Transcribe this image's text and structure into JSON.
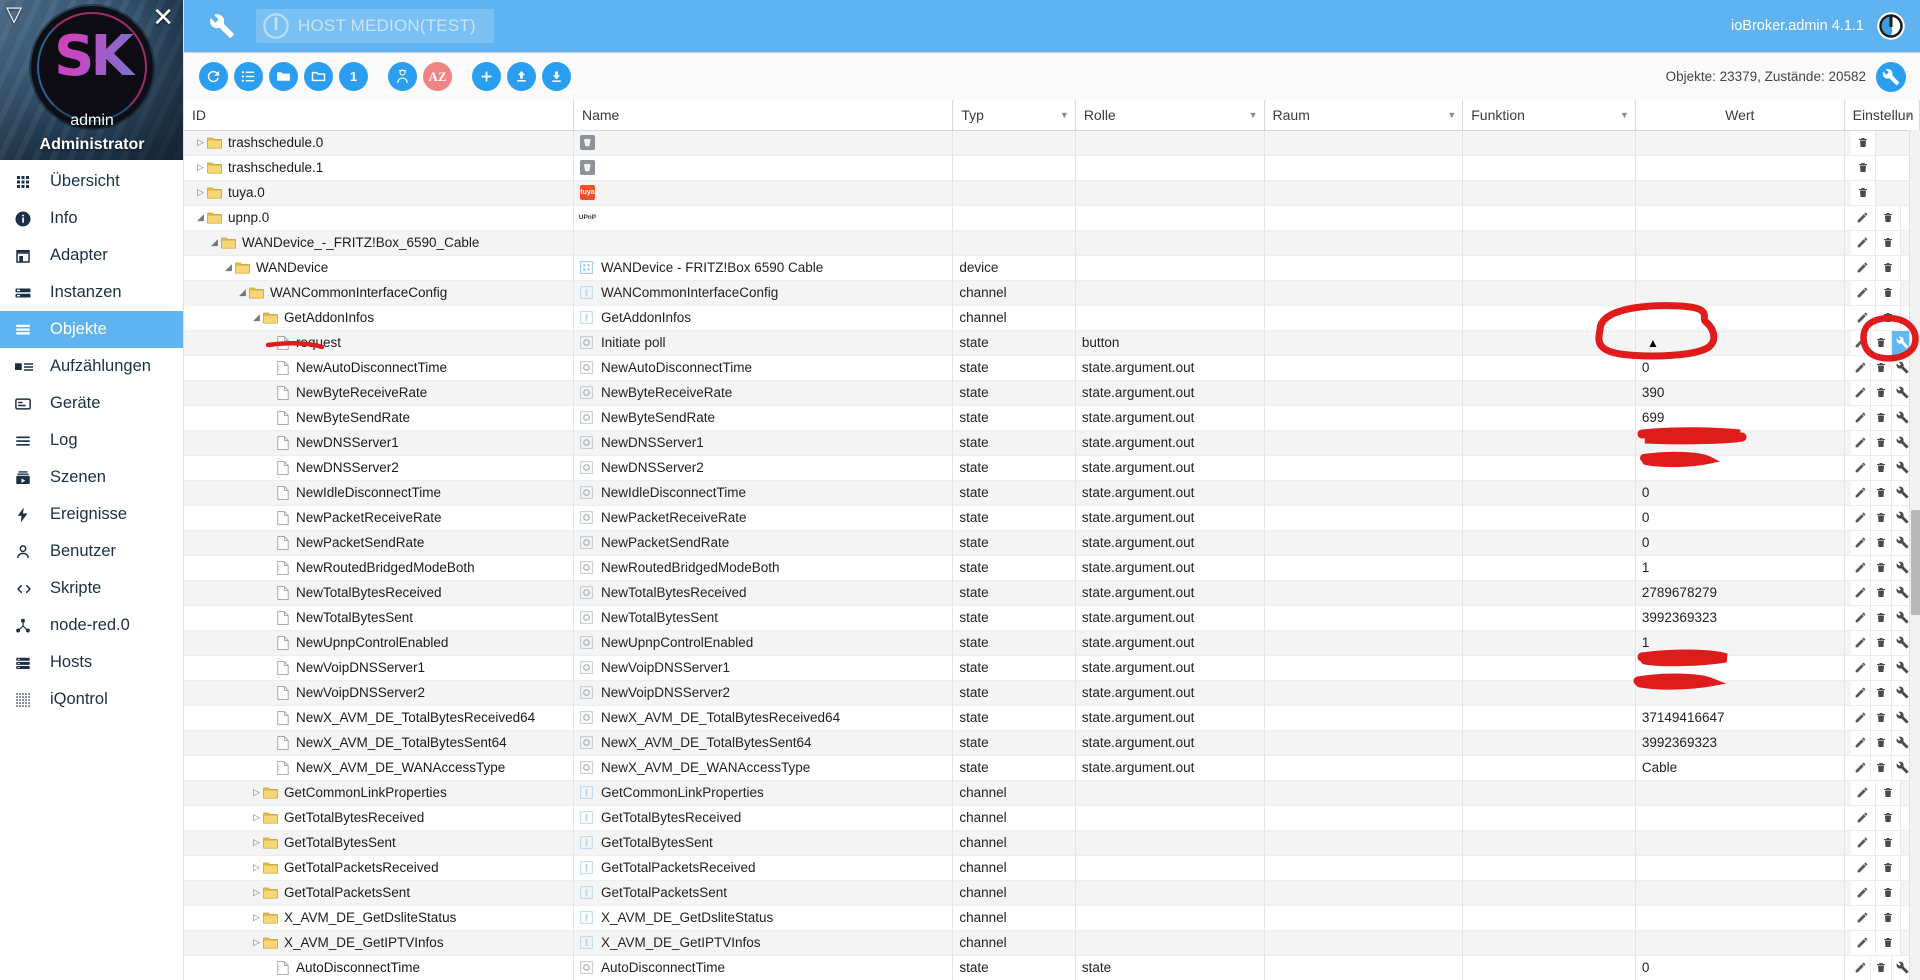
{
  "sidebar": {
    "user": "admin",
    "role": "Administrator",
    "logo_text": "SK",
    "collapse_icon": "collapse-triangle-icon",
    "close_icon": "close-icon",
    "items": [
      {
        "label": "Übersicht",
        "icon": "grid-icon",
        "active": false
      },
      {
        "label": "Info",
        "icon": "info-icon",
        "active": false
      },
      {
        "label": "Adapter",
        "icon": "shop-icon",
        "active": false
      },
      {
        "label": "Instanzen",
        "icon": "instances-icon",
        "active": false
      },
      {
        "label": "Objekte",
        "icon": "objects-icon",
        "active": true
      },
      {
        "label": "Aufzählungen",
        "icon": "enums-icon",
        "active": false
      },
      {
        "label": "Geräte",
        "icon": "devices-icon",
        "active": false
      },
      {
        "label": "Log",
        "icon": "log-icon",
        "active": false
      },
      {
        "label": "Szenen",
        "icon": "scenes-icon",
        "active": false
      },
      {
        "label": "Ereignisse",
        "icon": "events-icon",
        "active": false
      },
      {
        "label": "Benutzer",
        "icon": "user-icon",
        "active": false
      },
      {
        "label": "Skripte",
        "icon": "code-icon",
        "active": false
      },
      {
        "label": "node-red.0",
        "icon": "node-red-icon",
        "active": false
      },
      {
        "label": "Hosts",
        "icon": "hosts-icon",
        "active": false
      },
      {
        "label": "iQontrol",
        "icon": "iqontrol-icon",
        "active": false
      }
    ]
  },
  "topbar": {
    "wrench_icon": "wrench-icon",
    "host_label": "HOST MEDION(TEST)",
    "host_power_icon": "power-icon",
    "version": "ioBroker.admin 4.1.1",
    "logo_icon": "iobroker-logo-icon",
    "accent_color": "#5eb3f0"
  },
  "toolbar": {
    "buttons": [
      {
        "name": "refresh-button",
        "icon": "refresh-icon",
        "style": "blue"
      },
      {
        "name": "list-view-button",
        "icon": "list-icon",
        "style": "blue"
      },
      {
        "name": "expand-all-button",
        "icon": "folder-open-icon",
        "style": "blue"
      },
      {
        "name": "collapse-all-button",
        "icon": "folder-icon",
        "style": "blue"
      },
      {
        "name": "expand-level-button",
        "icon": "number-one-icon",
        "style": "blue",
        "text": "1"
      },
      {
        "name": "expert-mode-button",
        "icon": "expert-icon",
        "style": "blue"
      },
      {
        "name": "sort-alpha-button",
        "icon": "az-sort-icon",
        "style": "red",
        "text": "AZ"
      },
      {
        "name": "add-object-button",
        "icon": "plus-icon",
        "style": "blue"
      },
      {
        "name": "import-button",
        "icon": "upload-icon",
        "style": "blue"
      },
      {
        "name": "export-button",
        "icon": "download-icon",
        "style": "blue"
      }
    ],
    "counts": "Objekte: 23379, Zustände: 20582",
    "settings_icon": "wrench-icon"
  },
  "table": {
    "columns": [
      {
        "label": "ID",
        "filter": false,
        "align": "left"
      },
      {
        "label": "Name",
        "filter": false,
        "align": "left"
      },
      {
        "label": "Typ",
        "filter": true,
        "align": "left"
      },
      {
        "label": "Rolle",
        "filter": true,
        "align": "left"
      },
      {
        "label": "Raum",
        "filter": true,
        "align": "left"
      },
      {
        "label": "Funktion",
        "filter": true,
        "align": "left"
      },
      {
        "label": "Wert",
        "filter": false,
        "align": "center"
      },
      {
        "label": "Einstellun",
        "filter": true,
        "align": "left"
      }
    ],
    "rows": [
      {
        "indent": 0,
        "twisty": "closed",
        "icon": "folder-icon",
        "id": "trashschedule.0",
        "name": "",
        "name_icon": "trashschedule-adapter-icon",
        "type": "",
        "role": "",
        "room": "",
        "func": "",
        "value": "",
        "actions": [
          "delete"
        ]
      },
      {
        "indent": 0,
        "twisty": "closed",
        "icon": "folder-icon",
        "id": "trashschedule.1",
        "name": "",
        "name_icon": "trashschedule-adapter-icon",
        "type": "",
        "role": "",
        "room": "",
        "func": "",
        "value": "",
        "actions": [
          "delete"
        ]
      },
      {
        "indent": 0,
        "twisty": "closed",
        "icon": "folder-icon",
        "id": "tuya.0",
        "name": "",
        "name_icon": "tuya-adapter-icon",
        "type": "",
        "role": "",
        "room": "",
        "func": "",
        "value": "",
        "actions": [
          "delete"
        ]
      },
      {
        "indent": 0,
        "twisty": "open",
        "icon": "folder-icon",
        "id": "upnp.0",
        "name": "",
        "name_icon": "upnp-adapter-icon",
        "type": "",
        "role": "",
        "room": "",
        "func": "",
        "value": "",
        "actions": [
          "edit",
          "delete"
        ]
      },
      {
        "indent": 1,
        "twisty": "open",
        "icon": "folder-icon",
        "id": "WANDevice_-_FRITZ!Box_6590_Cable",
        "name": "",
        "name_icon": "",
        "type": "",
        "role": "",
        "room": "",
        "func": "",
        "value": "",
        "actions": [
          "edit",
          "delete"
        ]
      },
      {
        "indent": 2,
        "twisty": "open",
        "icon": "folder-icon",
        "id": "WANDevice",
        "name": "WANDevice - FRITZ!Box 6590 Cable",
        "name_icon": "device-icon",
        "type": "device",
        "role": "",
        "room": "",
        "func": "",
        "value": "",
        "actions": [
          "edit",
          "delete"
        ]
      },
      {
        "indent": 3,
        "twisty": "open",
        "icon": "folder-icon",
        "id": "WANCommonInterfaceConfig",
        "name": "WANCommonInterfaceConfig",
        "name_icon": "channel-icon",
        "type": "channel",
        "role": "",
        "room": "",
        "func": "",
        "value": "",
        "actions": [
          "edit",
          "delete"
        ]
      },
      {
        "indent": 4,
        "twisty": "open",
        "icon": "folder-icon",
        "id": "GetAddonInfos",
        "name": "GetAddonInfos",
        "name_icon": "channel-icon",
        "type": "channel",
        "role": "",
        "room": "",
        "func": "",
        "value": "",
        "actions": [
          "edit",
          "delete"
        ]
      },
      {
        "indent": 5,
        "twisty": "none",
        "icon": "doc-icon",
        "id": "request",
        "name": "Initiate poll",
        "name_icon": "state-icon",
        "type": "state",
        "role": "button",
        "room": "",
        "func": "",
        "value": "▲",
        "value_kind": "button",
        "actions": [
          "edit",
          "delete",
          "settings-highlight"
        ]
      },
      {
        "indent": 5,
        "twisty": "none",
        "icon": "doc-icon",
        "id": "NewAutoDisconnectTime",
        "name": "NewAutoDisconnectTime",
        "name_icon": "state-icon",
        "type": "state",
        "role": "state.argument.out",
        "room": "",
        "func": "",
        "value": "0",
        "actions": [
          "edit",
          "delete",
          "settings"
        ]
      },
      {
        "indent": 5,
        "twisty": "none",
        "icon": "doc-icon",
        "id": "NewByteReceiveRate",
        "name": "NewByteReceiveRate",
        "name_icon": "state-icon",
        "type": "state",
        "role": "state.argument.out",
        "room": "",
        "func": "",
        "value": "390",
        "actions": [
          "edit",
          "delete",
          "settings"
        ]
      },
      {
        "indent": 5,
        "twisty": "none",
        "icon": "doc-icon",
        "id": "NewByteSendRate",
        "name": "NewByteSendRate",
        "name_icon": "state-icon",
        "type": "state",
        "role": "state.argument.out",
        "room": "",
        "func": "",
        "value": "699",
        "actions": [
          "edit",
          "delete",
          "settings"
        ]
      },
      {
        "indent": 5,
        "twisty": "none",
        "icon": "doc-icon",
        "id": "NewDNSServer1",
        "name": "NewDNSServer1",
        "name_icon": "state-icon",
        "type": "state",
        "role": "state.argument.out",
        "room": "",
        "func": "",
        "value": "",
        "value_kind": "redacted-long",
        "actions": [
          "edit",
          "delete",
          "settings"
        ]
      },
      {
        "indent": 5,
        "twisty": "none",
        "icon": "doc-icon",
        "id": "NewDNSServer2",
        "name": "NewDNSServer2",
        "name_icon": "state-icon",
        "type": "state",
        "role": "state.argument.out",
        "room": "",
        "func": "",
        "value": "",
        "value_kind": "redacted-short",
        "actions": [
          "edit",
          "delete",
          "settings"
        ]
      },
      {
        "indent": 5,
        "twisty": "none",
        "icon": "doc-icon",
        "id": "NewIdleDisconnectTime",
        "name": "NewIdleDisconnectTime",
        "name_icon": "state-icon",
        "type": "state",
        "role": "state.argument.out",
        "room": "",
        "func": "",
        "value": "0",
        "actions": [
          "edit",
          "delete",
          "settings"
        ]
      },
      {
        "indent": 5,
        "twisty": "none",
        "icon": "doc-icon",
        "id": "NewPacketReceiveRate",
        "name": "NewPacketReceiveRate",
        "name_icon": "state-icon",
        "type": "state",
        "role": "state.argument.out",
        "room": "",
        "func": "",
        "value": "0",
        "actions": [
          "edit",
          "delete",
          "settings"
        ]
      },
      {
        "indent": 5,
        "twisty": "none",
        "icon": "doc-icon",
        "id": "NewPacketSendRate",
        "name": "NewPacketSendRate",
        "name_icon": "state-icon",
        "type": "state",
        "role": "state.argument.out",
        "room": "",
        "func": "",
        "value": "0",
        "actions": [
          "edit",
          "delete",
          "settings"
        ]
      },
      {
        "indent": 5,
        "twisty": "none",
        "icon": "doc-icon",
        "id": "NewRoutedBridgedModeBoth",
        "name": "NewRoutedBridgedModeBoth",
        "name_icon": "state-icon",
        "type": "state",
        "role": "state.argument.out",
        "room": "",
        "func": "",
        "value": "1",
        "actions": [
          "edit",
          "delete",
          "settings"
        ]
      },
      {
        "indent": 5,
        "twisty": "none",
        "icon": "doc-icon",
        "id": "NewTotalBytesReceived",
        "name": "NewTotalBytesReceived",
        "name_icon": "state-icon",
        "type": "state",
        "role": "state.argument.out",
        "room": "",
        "func": "",
        "value": "2789678279",
        "actions": [
          "edit",
          "delete",
          "settings"
        ]
      },
      {
        "indent": 5,
        "twisty": "none",
        "icon": "doc-icon",
        "id": "NewTotalBytesSent",
        "name": "NewTotalBytesSent",
        "name_icon": "state-icon",
        "type": "state",
        "role": "state.argument.out",
        "room": "",
        "func": "",
        "value": "3992369323",
        "actions": [
          "edit",
          "delete",
          "settings"
        ]
      },
      {
        "indent": 5,
        "twisty": "none",
        "icon": "doc-icon",
        "id": "NewUpnpControlEnabled",
        "name": "NewUpnpControlEnabled",
        "name_icon": "state-icon",
        "type": "state",
        "role": "state.argument.out",
        "room": "",
        "func": "",
        "value": "1",
        "actions": [
          "edit",
          "delete",
          "settings"
        ]
      },
      {
        "indent": 5,
        "twisty": "none",
        "icon": "doc-icon",
        "id": "NewVoipDNSServer1",
        "name": "NewVoipDNSServer1",
        "name_icon": "state-icon",
        "type": "state",
        "role": "state.argument.out",
        "room": "",
        "func": "",
        "value": "",
        "value_kind": "redacted-long",
        "actions": [
          "edit",
          "delete",
          "settings"
        ]
      },
      {
        "indent": 5,
        "twisty": "none",
        "icon": "doc-icon",
        "id": "NewVoipDNSServer2",
        "name": "NewVoipDNSServer2",
        "name_icon": "state-icon",
        "type": "state",
        "role": "state.argument.out",
        "room": "",
        "func": "",
        "value": "",
        "value_kind": "redacted-short",
        "actions": [
          "edit",
          "delete",
          "settings"
        ]
      },
      {
        "indent": 5,
        "twisty": "none",
        "icon": "doc-icon",
        "id": "NewX_AVM_DE_TotalBytesReceived64",
        "name": "NewX_AVM_DE_TotalBytesReceived64",
        "name_icon": "state-icon",
        "type": "state",
        "role": "state.argument.out",
        "room": "",
        "func": "",
        "value": "37149416647",
        "actions": [
          "edit",
          "delete",
          "settings"
        ]
      },
      {
        "indent": 5,
        "twisty": "none",
        "icon": "doc-icon",
        "id": "NewX_AVM_DE_TotalBytesSent64",
        "name": "NewX_AVM_DE_TotalBytesSent64",
        "name_icon": "state-icon",
        "type": "state",
        "role": "state.argument.out",
        "room": "",
        "func": "",
        "value": "3992369323",
        "actions": [
          "edit",
          "delete",
          "settings"
        ]
      },
      {
        "indent": 5,
        "twisty": "none",
        "icon": "doc-icon",
        "id": "NewX_AVM_DE_WANAccessType",
        "name": "NewX_AVM_DE_WANAccessType",
        "name_icon": "state-icon",
        "type": "state",
        "role": "state.argument.out",
        "room": "",
        "func": "",
        "value": "Cable",
        "value_kind": "text",
        "actions": [
          "edit",
          "delete",
          "settings"
        ]
      },
      {
        "indent": 4,
        "twisty": "closed",
        "icon": "folder-icon",
        "id": "GetCommonLinkProperties",
        "name": "GetCommonLinkProperties",
        "name_icon": "channel-icon",
        "type": "channel",
        "role": "",
        "room": "",
        "func": "",
        "value": "",
        "actions": [
          "edit",
          "delete"
        ]
      },
      {
        "indent": 4,
        "twisty": "closed",
        "icon": "folder-icon",
        "id": "GetTotalBytesReceived",
        "name": "GetTotalBytesReceived",
        "name_icon": "channel-icon",
        "type": "channel",
        "role": "",
        "room": "",
        "func": "",
        "value": "",
        "actions": [
          "edit",
          "delete"
        ]
      },
      {
        "indent": 4,
        "twisty": "closed",
        "icon": "folder-icon",
        "id": "GetTotalBytesSent",
        "name": "GetTotalBytesSent",
        "name_icon": "channel-icon",
        "type": "channel",
        "role": "",
        "room": "",
        "func": "",
        "value": "",
        "actions": [
          "edit",
          "delete"
        ]
      },
      {
        "indent": 4,
        "twisty": "closed",
        "icon": "folder-icon",
        "id": "GetTotalPacketsReceived",
        "name": "GetTotalPacketsReceived",
        "name_icon": "channel-icon",
        "type": "channel",
        "role": "",
        "room": "",
        "func": "",
        "value": "",
        "actions": [
          "edit",
          "delete"
        ]
      },
      {
        "indent": 4,
        "twisty": "closed",
        "icon": "folder-icon",
        "id": "GetTotalPacketsSent",
        "name": "GetTotalPacketsSent",
        "name_icon": "channel-icon",
        "type": "channel",
        "role": "",
        "room": "",
        "func": "",
        "value": "",
        "actions": [
          "edit",
          "delete"
        ]
      },
      {
        "indent": 4,
        "twisty": "closed",
        "icon": "folder-icon",
        "id": "X_AVM_DE_GetDsliteStatus",
        "name": "X_AVM_DE_GetDsliteStatus",
        "name_icon": "channel-icon",
        "type": "channel",
        "role": "",
        "room": "",
        "func": "",
        "value": "",
        "actions": [
          "edit",
          "delete"
        ]
      },
      {
        "indent": 4,
        "twisty": "closed",
        "icon": "folder-icon",
        "id": "X_AVM_DE_GetIPTVInfos",
        "name": "X_AVM_DE_GetIPTVInfos",
        "name_icon": "channel-icon",
        "type": "channel",
        "role": "",
        "room": "",
        "func": "",
        "value": "",
        "actions": [
          "edit",
          "delete"
        ]
      },
      {
        "indent": 5,
        "twisty": "none",
        "icon": "doc-icon",
        "id": "AutoDisconnectTime",
        "name": "AutoDisconnectTime",
        "name_icon": "state-icon",
        "type": "state",
        "role": "state",
        "room": "",
        "func": "",
        "value": "0",
        "actions": [
          "edit",
          "delete",
          "settings"
        ]
      }
    ]
  },
  "annotations": {
    "color": "#e01b1b",
    "marks": [
      {
        "name": "circle-around-request-value",
        "type": "ellipse"
      },
      {
        "name": "circle-around-settings-wrench",
        "type": "ellipse"
      },
      {
        "name": "underline-request-id",
        "type": "underline"
      },
      {
        "name": "redaction-dns-server-1",
        "type": "scribble"
      },
      {
        "name": "redaction-dns-server-2",
        "type": "scribble"
      },
      {
        "name": "redaction-voip-dns-server-1",
        "type": "scribble"
      },
      {
        "name": "redaction-voip-dns-server-2",
        "type": "scribble"
      }
    ]
  }
}
